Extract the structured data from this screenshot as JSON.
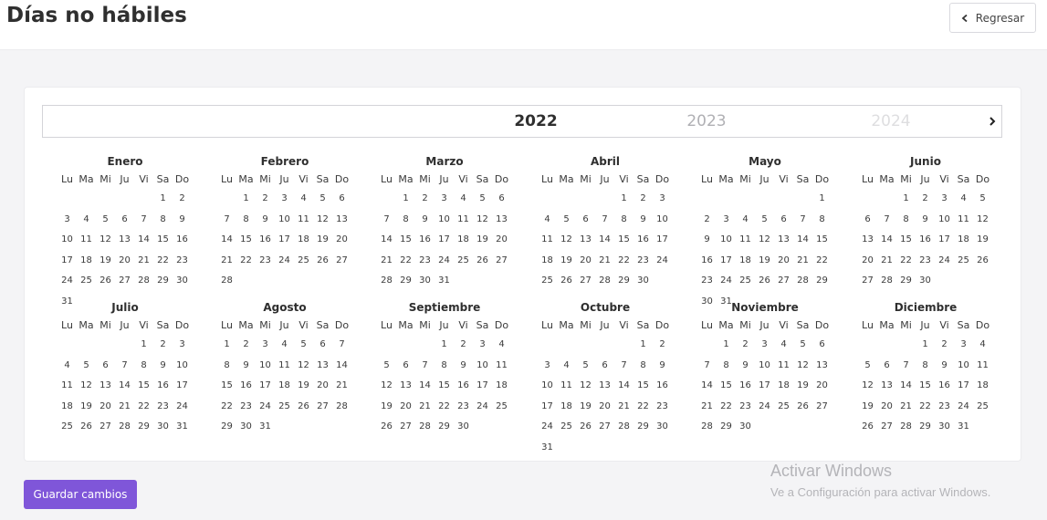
{
  "page": {
    "title": "Días no hábiles"
  },
  "header": {
    "back_label": "Regresar"
  },
  "years": {
    "current": "2022",
    "next": "2023",
    "after": "2024"
  },
  "weekdays": [
    "Lu",
    "Ma",
    "Mi",
    "Ju",
    "Vi",
    "Sa",
    "Do"
  ],
  "months": [
    {
      "name": "Enero",
      "days": 31,
      "offset": 5
    },
    {
      "name": "Febrero",
      "days": 28,
      "offset": 1
    },
    {
      "name": "Marzo",
      "days": 31,
      "offset": 1
    },
    {
      "name": "Abril",
      "days": 30,
      "offset": 4
    },
    {
      "name": "Mayo",
      "days": 31,
      "offset": 6
    },
    {
      "name": "Junio",
      "days": 30,
      "offset": 2
    },
    {
      "name": "Julio",
      "days": 31,
      "offset": 4
    },
    {
      "name": "Agosto",
      "days": 31,
      "offset": 0
    },
    {
      "name": "Septiembre",
      "days": 30,
      "offset": 3
    },
    {
      "name": "Octubre",
      "days": 31,
      "offset": 5
    },
    {
      "name": "Noviembre",
      "days": 30,
      "offset": 1
    },
    {
      "name": "Diciembre",
      "days": 31,
      "offset": 3
    }
  ],
  "footer": {
    "save_label": "Guardar cambios"
  },
  "watermark": {
    "title": "Activar Windows",
    "subtitle": "Ve a Configuración para activar Windows."
  },
  "icons": {
    "back": "chevron-left-icon",
    "next_year": "chevron-right-icon"
  },
  "colors": {
    "primary": "#7f56d9",
    "text": "#2f2f2f",
    "background": "#f4f4f6"
  }
}
